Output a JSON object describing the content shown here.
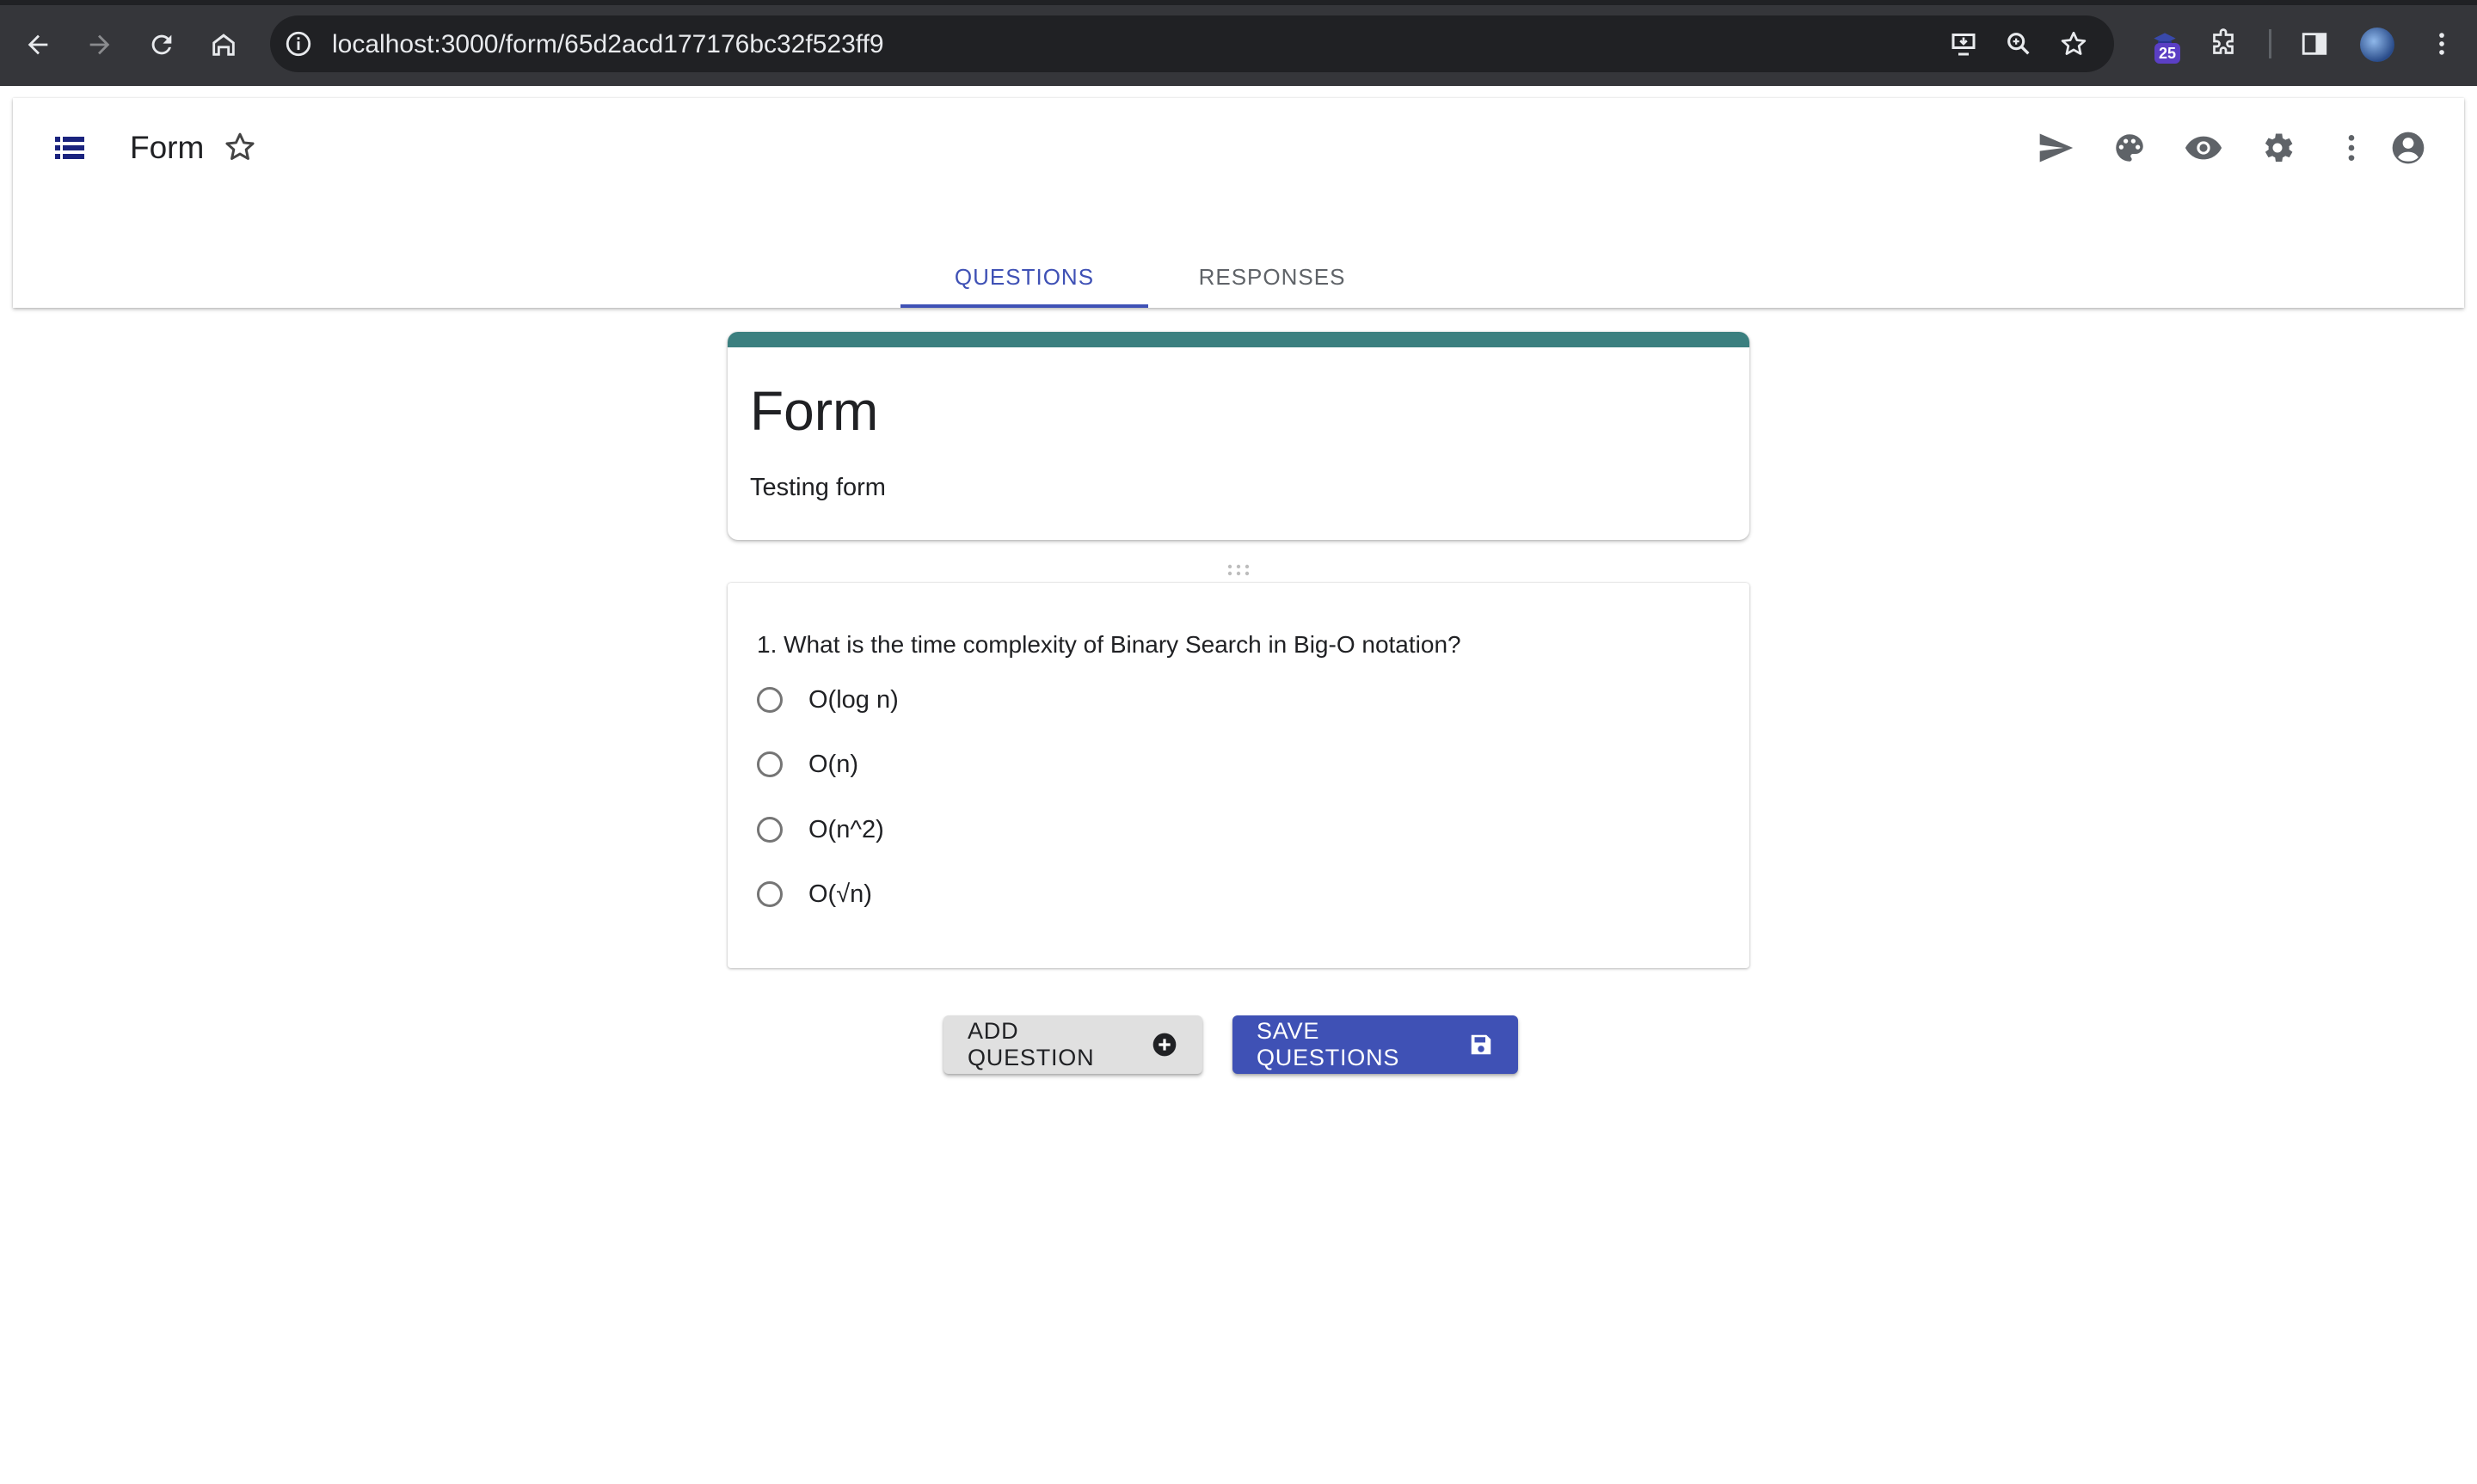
{
  "browser": {
    "url": "localhost:3000/form/65d2acd177176bc32f523ff9",
    "extension_badge": "25"
  },
  "header": {
    "title": "Form",
    "tabs": [
      {
        "label": "QUESTIONS",
        "active": true
      },
      {
        "label": "RESPONSES",
        "active": false
      }
    ],
    "actions": [
      "send-icon",
      "palette-icon",
      "eye-icon",
      "gear-icon",
      "more-vert-icon",
      "account-icon"
    ]
  },
  "form": {
    "title": "Form",
    "description": "Testing form",
    "accent_color": "#3b7f7f"
  },
  "question": {
    "text": "1. What is the time complexity of Binary Search in Big-O notation?",
    "options": [
      "O(log n)",
      "O(n)",
      "O(n^2)",
      "O(√n)"
    ]
  },
  "buttons": {
    "add_label": "ADD QUESTION",
    "save_label": "SAVE QUESTIONS"
  },
  "colors": {
    "primary": "#3f51b5",
    "browser_bar": "#35363a",
    "omnibox": "#202124"
  }
}
